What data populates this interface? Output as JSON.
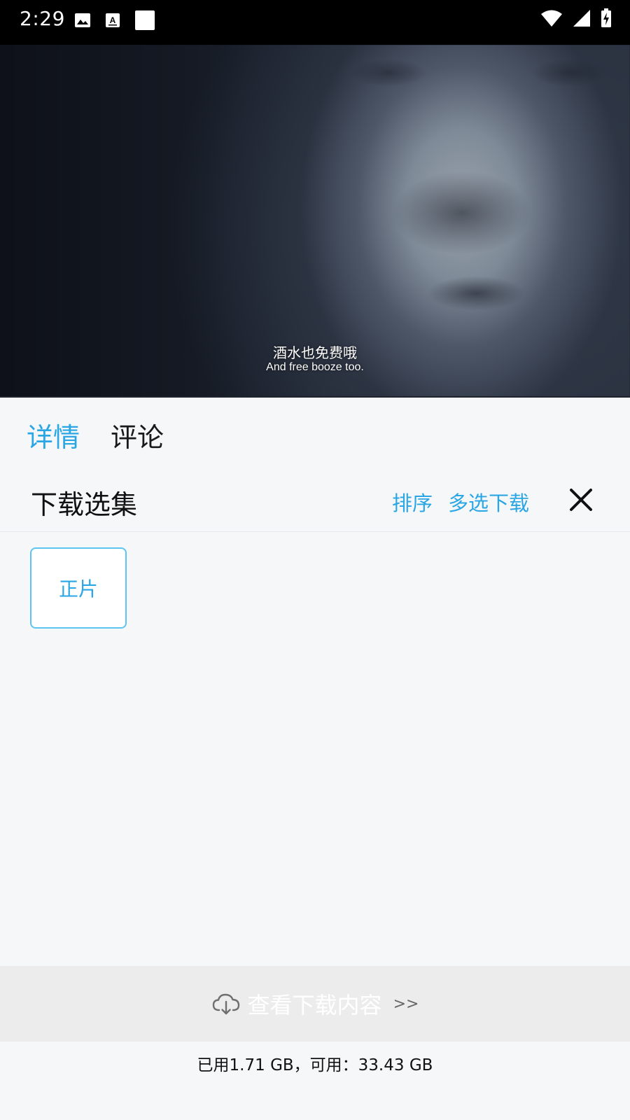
{
  "status_bar": {
    "time": "2:29",
    "left_icons": [
      "image-icon",
      "font-icon",
      "square-icon"
    ],
    "right_icons": [
      "wifi-icon",
      "signal-icon",
      "battery-charging-icon"
    ]
  },
  "video": {
    "subtitle_cn": "酒水也免费哦",
    "subtitle_en": "And free booze too."
  },
  "tabs": [
    {
      "label": "详情",
      "active": true
    },
    {
      "label": "评论",
      "active": false
    }
  ],
  "download_panel": {
    "title": "下载选集",
    "sort_label": "排序",
    "multi_download_label": "多选下载",
    "close_icon": "close-icon",
    "episodes": [
      {
        "label": "正片"
      }
    ]
  },
  "footer": {
    "view_downloads_label": "查看下载内容",
    "view_downloads_arrows": ">>",
    "storage_text": "已用1.71 GB，可用：33.43 GB"
  },
  "colors": {
    "accent": "#2aa6e4",
    "tile_border": "#5bc4f0",
    "background": "#f6f7f9",
    "footer_bar": "#ececec"
  }
}
